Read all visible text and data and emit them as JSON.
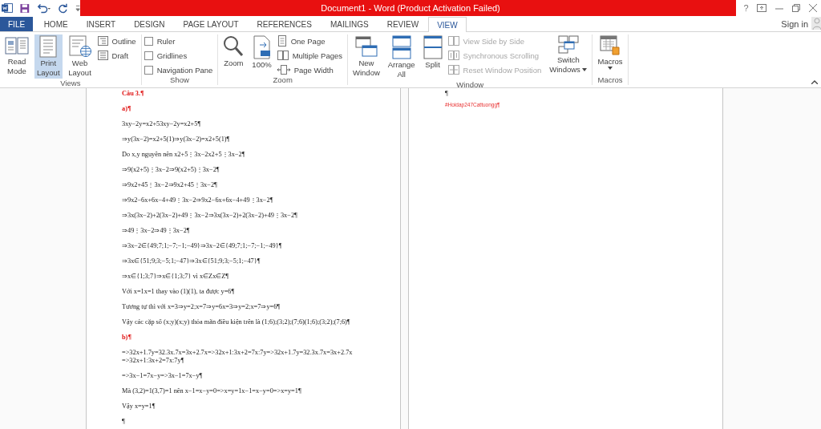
{
  "title_bar": {
    "title": "Document1 -  Word (Product Activation Failed)",
    "help": "?"
  },
  "tabs": [
    {
      "label": "FILE",
      "kind": "file",
      "selected": false
    },
    {
      "label": "HOME",
      "kind": "tab",
      "selected": false
    },
    {
      "label": "INSERT",
      "kind": "tab",
      "selected": false
    },
    {
      "label": "DESIGN",
      "kind": "tab",
      "selected": false
    },
    {
      "label": "PAGE LAYOUT",
      "kind": "tab",
      "selected": false
    },
    {
      "label": "REFERENCES",
      "kind": "tab",
      "selected": false
    },
    {
      "label": "MAILINGS",
      "kind": "tab",
      "selected": false
    },
    {
      "label": "REVIEW",
      "kind": "tab",
      "selected": false
    },
    {
      "label": "VIEW",
      "kind": "tab",
      "selected": true
    }
  ],
  "account": {
    "label": "Sign in"
  },
  "ribbon": {
    "groups": [
      {
        "label": "Views",
        "items": [
          {
            "kind": "large",
            "lines": [
              "Read",
              "Mode"
            ],
            "selected": false,
            "disabled": false
          },
          {
            "kind": "large",
            "lines": [
              "Print",
              "Layout"
            ],
            "selected": true,
            "disabled": false
          },
          {
            "kind": "large",
            "lines": [
              "Web",
              "Layout"
            ],
            "selected": false,
            "disabled": false
          },
          {
            "kind": "small",
            "lines": [
              "Outline"
            ],
            "selected": false,
            "disabled": false
          },
          {
            "kind": "small",
            "lines": [
              "Draft"
            ],
            "selected": false,
            "disabled": false
          }
        ]
      },
      {
        "label": "Show",
        "items": [
          {
            "kind": "check",
            "lines": [
              "Ruler"
            ],
            "checked": false,
            "disabled": false
          },
          {
            "kind": "check",
            "lines": [
              "Gridlines"
            ],
            "checked": false,
            "disabled": false
          },
          {
            "kind": "check",
            "lines": [
              "Navigation Pane"
            ],
            "checked": false,
            "disabled": false
          }
        ]
      },
      {
        "label": "Zoom",
        "items": [
          {
            "kind": "large",
            "lines": [
              "Zoom"
            ],
            "disabled": false
          },
          {
            "kind": "large",
            "lines": [
              "100%"
            ],
            "disabled": false
          },
          {
            "kind": "small",
            "lines": [
              "One Page"
            ],
            "disabled": false
          },
          {
            "kind": "small",
            "lines": [
              "Multiple Pages"
            ],
            "disabled": false
          },
          {
            "kind": "small",
            "lines": [
              "Page Width"
            ],
            "disabled": false
          }
        ]
      },
      {
        "label": "Window",
        "items": [
          {
            "kind": "large",
            "lines": [
              "New",
              "Window"
            ],
            "disabled": false,
            "dropdown": false
          },
          {
            "kind": "large",
            "lines": [
              "Arrange",
              "All"
            ],
            "disabled": false,
            "dropdown": false
          },
          {
            "kind": "large",
            "lines": [
              "Split"
            ],
            "disabled": false,
            "dropdown": false
          },
          {
            "kind": "small",
            "lines": [
              "View Side by Side"
            ],
            "disabled": true
          },
          {
            "kind": "small",
            "lines": [
              "Synchronous Scrolling"
            ],
            "disabled": true
          },
          {
            "kind": "small",
            "lines": [
              "Reset Window Position"
            ],
            "disabled": true
          },
          {
            "kind": "large",
            "lines": [
              "Switch",
              "Windows"
            ],
            "disabled": false,
            "dropdown": true
          }
        ]
      },
      {
        "label": "Macros",
        "items": [
          {
            "kind": "large",
            "lines": [
              "Macros"
            ],
            "disabled": false,
            "dropdown": true
          }
        ]
      }
    ]
  },
  "pages": [
    {
      "paragraphs": [
        {
          "kind": "heading",
          "text": "Câu 3.¶"
        },
        {
          "kind": "heading",
          "text": "a)¶"
        },
        {
          "kind": "text",
          "text": "3xy−2y=x2+53xy−2y=x2+5¶"
        },
        {
          "kind": "text",
          "text": "⇒y(3x−2)=x2+5(1)⇒y(3x−2)=x2+5(1)¶"
        },
        {
          "kind": "text",
          "text": "Do x,y nguyên nên x2+5⋮3x−2x2+5⋮3x−2¶"
        },
        {
          "kind": "text",
          "text": "⇒9(x2+5)⋮3x−2⇒9(x2+5)⋮3x−2¶"
        },
        {
          "kind": "text",
          "text": "⇒9x2+45⋮3x−2⇒9x2+45⋮3x−2¶"
        },
        {
          "kind": "text",
          "text": "⇒9x2−6x+6x−4+49⋮3x−2⇒9x2−6x+6x−4+49⋮3x−2¶"
        },
        {
          "kind": "text",
          "text": "⇒3x(3x−2)+2(3x−2)+49⋮3x−2⇒3x(3x−2)+2(3x−2)+49⋮3x−2¶"
        },
        {
          "kind": "text",
          "text": "⇒49⋮3x−2⇒49⋮3x−2¶"
        },
        {
          "kind": "text",
          "text": "⇒3x−2∈{49;7;1;−7;−1;−49}⇒3x−2∈{49;7;1;−7;−1;−49}¶"
        },
        {
          "kind": "text",
          "text": "⇒3x∈{51;9;3;−5;1;−47}⇒3x∈{51;9;3;−5;1;−47}¶"
        },
        {
          "kind": "text",
          "text": "⇒x∈{1;3;7}⇒x∈{1;3;7} vì x∈Zx∈Z¶"
        },
        {
          "kind": "text",
          "text": "Với x=1x=1 thay vào (1)(1), ta được y=6¶"
        },
        {
          "kind": "text",
          "text": "Tương tự thì với x=3⇒y=2;x=7⇒y=6x=3⇒y=2;x=7⇒y=6¶"
        },
        {
          "kind": "text",
          "text": "Vậy các cặp số (x;y)(x;y) thỏa mãn điều kiện trên là (1;6);(3;2);(7;6)(1;6);(3;2);(7;6)¶"
        },
        {
          "kind": "heading",
          "text": "b)¶"
        },
        {
          "kind": "text",
          "text": "=>32x+1.7y=32.3x.7x=3x+2.7x=>32x+1:3x+2=7x:7y=>32x+1.7y=32.3x.7x=3x+2.7x =>32x+1:3x+2=7x:7y¶"
        },
        {
          "kind": "text",
          "text": "=>3x−1=7x−y=>3x−1=7x−y¶"
        },
        {
          "kind": "text",
          "text": "Mà (3,2)=1(3,7)=1 nên x−1=x−y=0=>x=y=1x−1=x−y=0=>x=y=1¶"
        },
        {
          "kind": "text",
          "text": "Vậy x=y=1¶"
        },
        {
          "kind": "text",
          "text": "¶"
        }
      ]
    },
    {
      "paragraphs": [
        {
          "kind": "text",
          "text": "¶"
        },
        {
          "kind": "tag",
          "text": "#Hoidap247Cattuongg¶"
        }
      ]
    }
  ]
}
